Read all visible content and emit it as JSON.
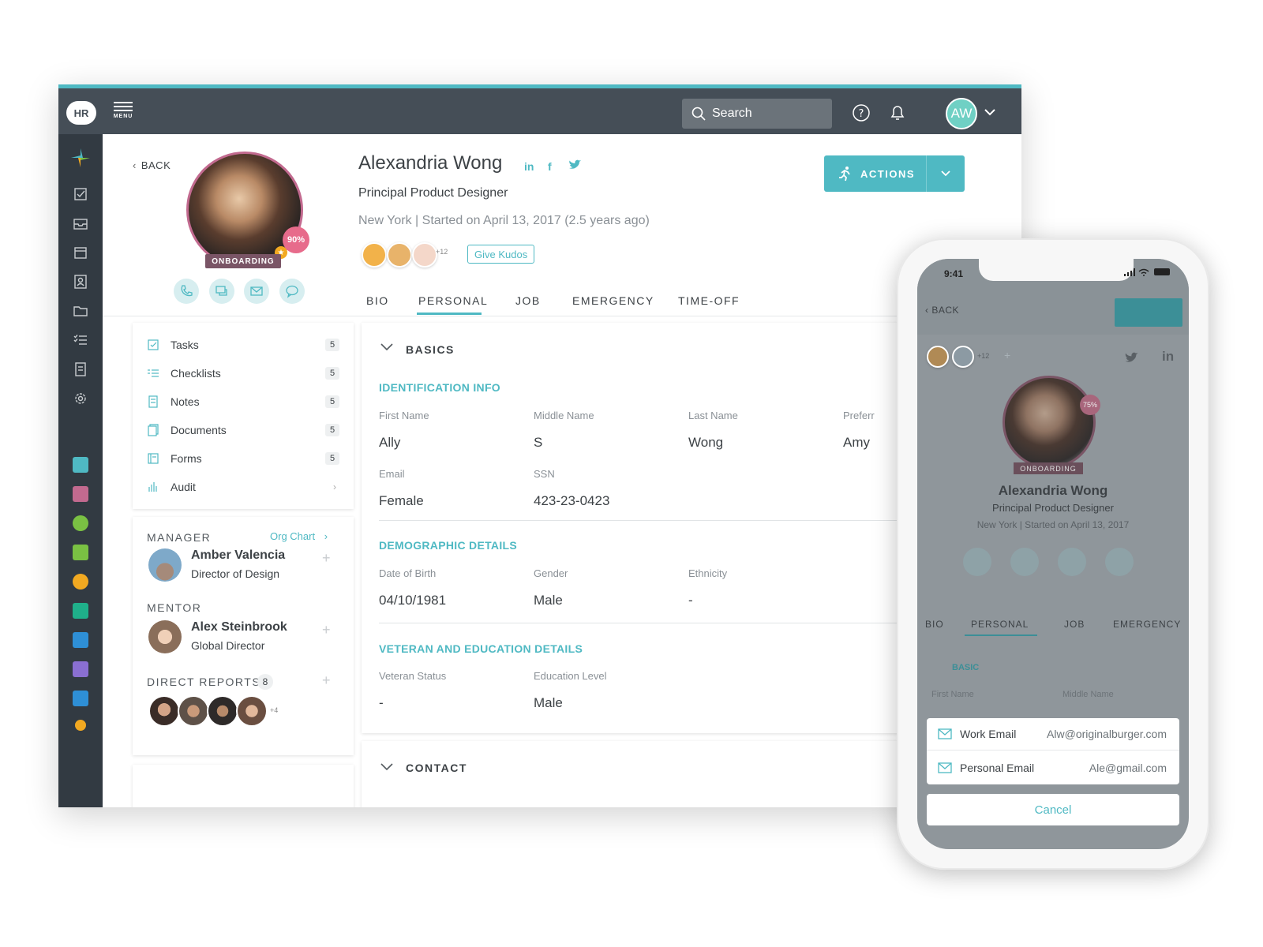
{
  "topbar": {
    "logo": "HR",
    "menu_label": "MENU",
    "search_placeholder": "Search",
    "user_initials": "AW"
  },
  "profile": {
    "back_label": "BACK",
    "name": "Alexandria Wong",
    "social": [
      "in",
      "f"
    ],
    "title": "Principal Product Designer",
    "location_line": "New York  |  Started on April 13, 2017 (2.5 years ago)",
    "completion": "90%",
    "status_badge": "ONBOARDING",
    "kudos_more": "+12",
    "give_kudos": "Give Kudos",
    "actions_label": "ACTIONS"
  },
  "tabs": [
    "BIO",
    "PERSONAL",
    "JOB",
    "EMERGENCY",
    "TIME-OFF"
  ],
  "side_list": [
    {
      "label": "Tasks",
      "count": "5"
    },
    {
      "label": "Checklists",
      "count": "5"
    },
    {
      "label": "Notes",
      "count": "5"
    },
    {
      "label": "Documents",
      "count": "5"
    },
    {
      "label": "Forms",
      "count": "5"
    },
    {
      "label": "Audit",
      "count": ""
    }
  ],
  "people": {
    "manager_label": "MANAGER",
    "org_chart": "Org Chart",
    "manager_name": "Amber Valencia",
    "manager_role": "Director of Design",
    "mentor_label": "MENTOR",
    "mentor_name": "Alex Steinbrook",
    "mentor_role": "Global Director",
    "direct_reports_label": "DIRECT REPORTS",
    "direct_reports_count": "8",
    "direct_reports_more": "+4"
  },
  "details": {
    "basics": "BASICS",
    "identification": "IDENTIFICATION INFO",
    "first_name_label": "First Name",
    "first_name": "Ally",
    "middle_name_label": "Middle Name",
    "middle_name": "S",
    "last_name_label": "Last Name",
    "last_name": "Wong",
    "preferred_label": "Preferr",
    "preferred": "Amy",
    "email_label": "Email",
    "email": "Female",
    "ssn_label": "SSN",
    "ssn": "423-23-0423",
    "demographic": "DEMOGRAPHIC DETAILS",
    "dob_label": "Date of Birth",
    "dob": "04/10/1981",
    "gender_label": "Gender",
    "gender": "Male",
    "ethnicity_label": "Ethnicity",
    "ethnicity": "-",
    "veteran_edu": "VETERAN AND EDUCATION DETAILS",
    "veteran_label": "Veteran Status",
    "veteran": "-",
    "education_label": "Education Level",
    "education": "Male",
    "contact": "CONTACT"
  },
  "phone": {
    "time": "9:41",
    "back": "BACK",
    "kudos_more": "+12",
    "completion": "75%",
    "status_badge": "ONBOARDING",
    "name": "Alexandria Wong",
    "title": "Principal Product Designer",
    "location_line": "New York  |  Started on April 13, 2017",
    "tabs": [
      "BIO",
      "PERSONAL",
      "JOB",
      "EMERGENCY"
    ],
    "basic": "BASIC",
    "first_name_label": "First Name",
    "middle_name_label": "Middle Name",
    "work_email_label": "Work Email",
    "work_email": "Alw@originalburger.com",
    "personal_email_label": "Personal Email",
    "personal_email": "Ale@gmail.com",
    "cancel": "Cancel"
  },
  "colors": {
    "accent": "#4fb9c3",
    "topbar": "#454e57",
    "sidebar": "#323a42",
    "onboarding_badge": "#7a5566",
    "completion_badge": "#e76b8b"
  }
}
